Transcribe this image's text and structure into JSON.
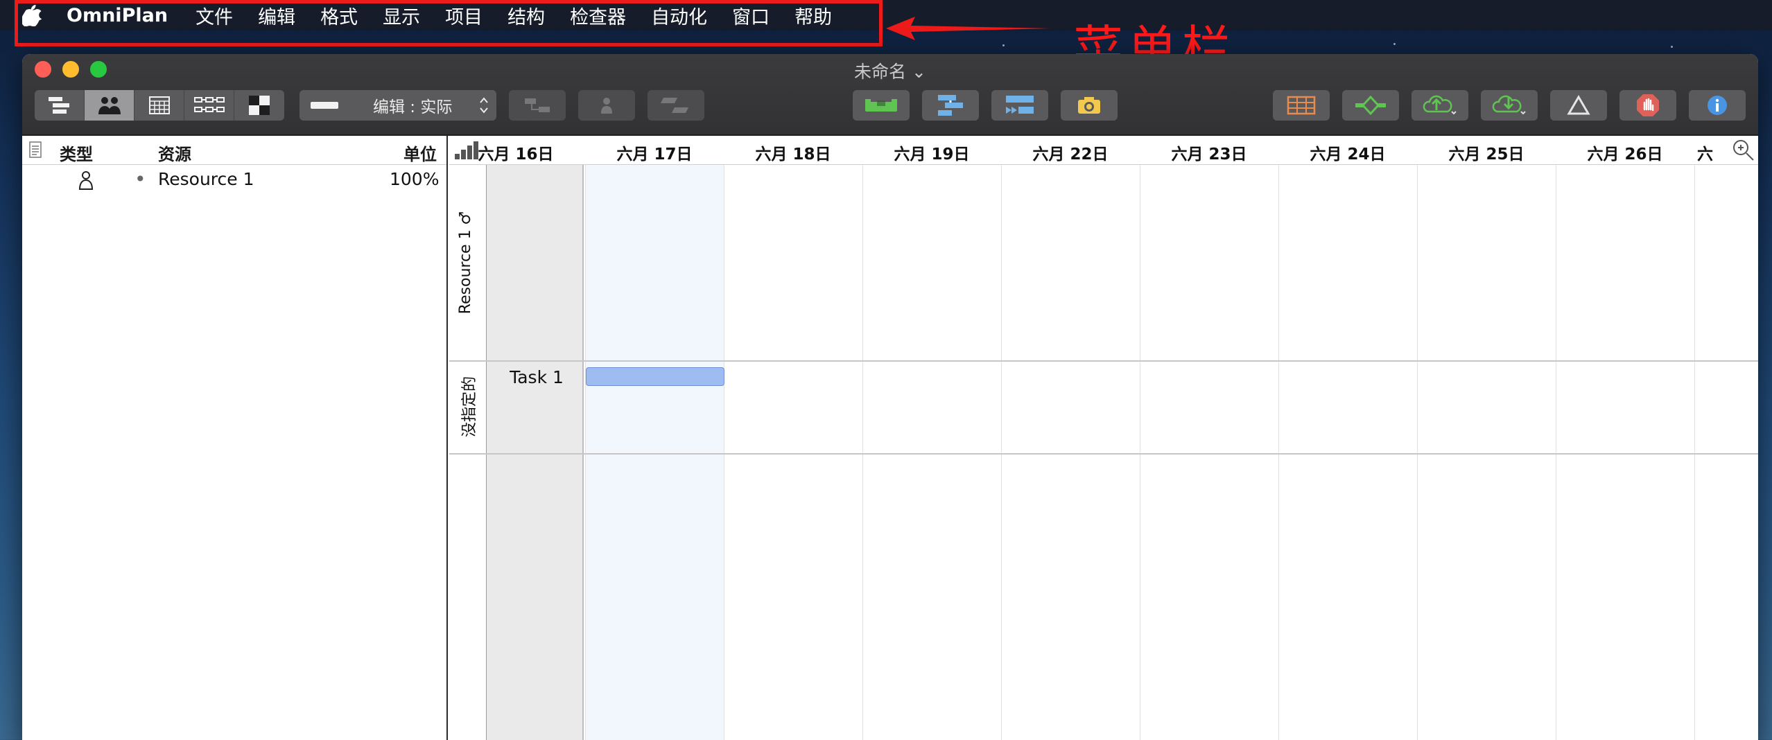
{
  "menubar": {
    "app_name": "OmniPlan",
    "items": [
      "文件",
      "编辑",
      "格式",
      "显示",
      "项目",
      "结构",
      "检查器",
      "自动化",
      "窗口",
      "帮助"
    ]
  },
  "annotation": {
    "label": "菜单栏",
    "color": "#ee1b1b"
  },
  "window": {
    "title": "未命名 ⌄",
    "view_mode_popup": "编辑 : 实际",
    "view_segments": [
      "task-outline-icon",
      "resources-icon",
      "calendar-icon",
      "network-icon",
      "styles-icon"
    ],
    "selected_segment": "resources-icon"
  },
  "resource_table": {
    "headers": {
      "type": "类型",
      "resource": "资源",
      "units": "单位"
    },
    "rows": [
      {
        "type_icon": "person-icon",
        "name": "Resource 1",
        "units": "100%"
      }
    ]
  },
  "gantt": {
    "dates": [
      "六月 16日",
      "六月 17日",
      "六月 18日",
      "六月 19日",
      "六月 22日",
      "六月 23日",
      "六月 24日",
      "六月 25日",
      "六月 26日",
      "六"
    ],
    "groups": [
      {
        "label": "Resource 1 ♂"
      },
      {
        "label": "没指定的"
      }
    ],
    "tasks": [
      {
        "name": "Task 1",
        "start": "六月 17日",
        "end": "六月 17日",
        "color": "#9ebcf2"
      }
    ]
  }
}
